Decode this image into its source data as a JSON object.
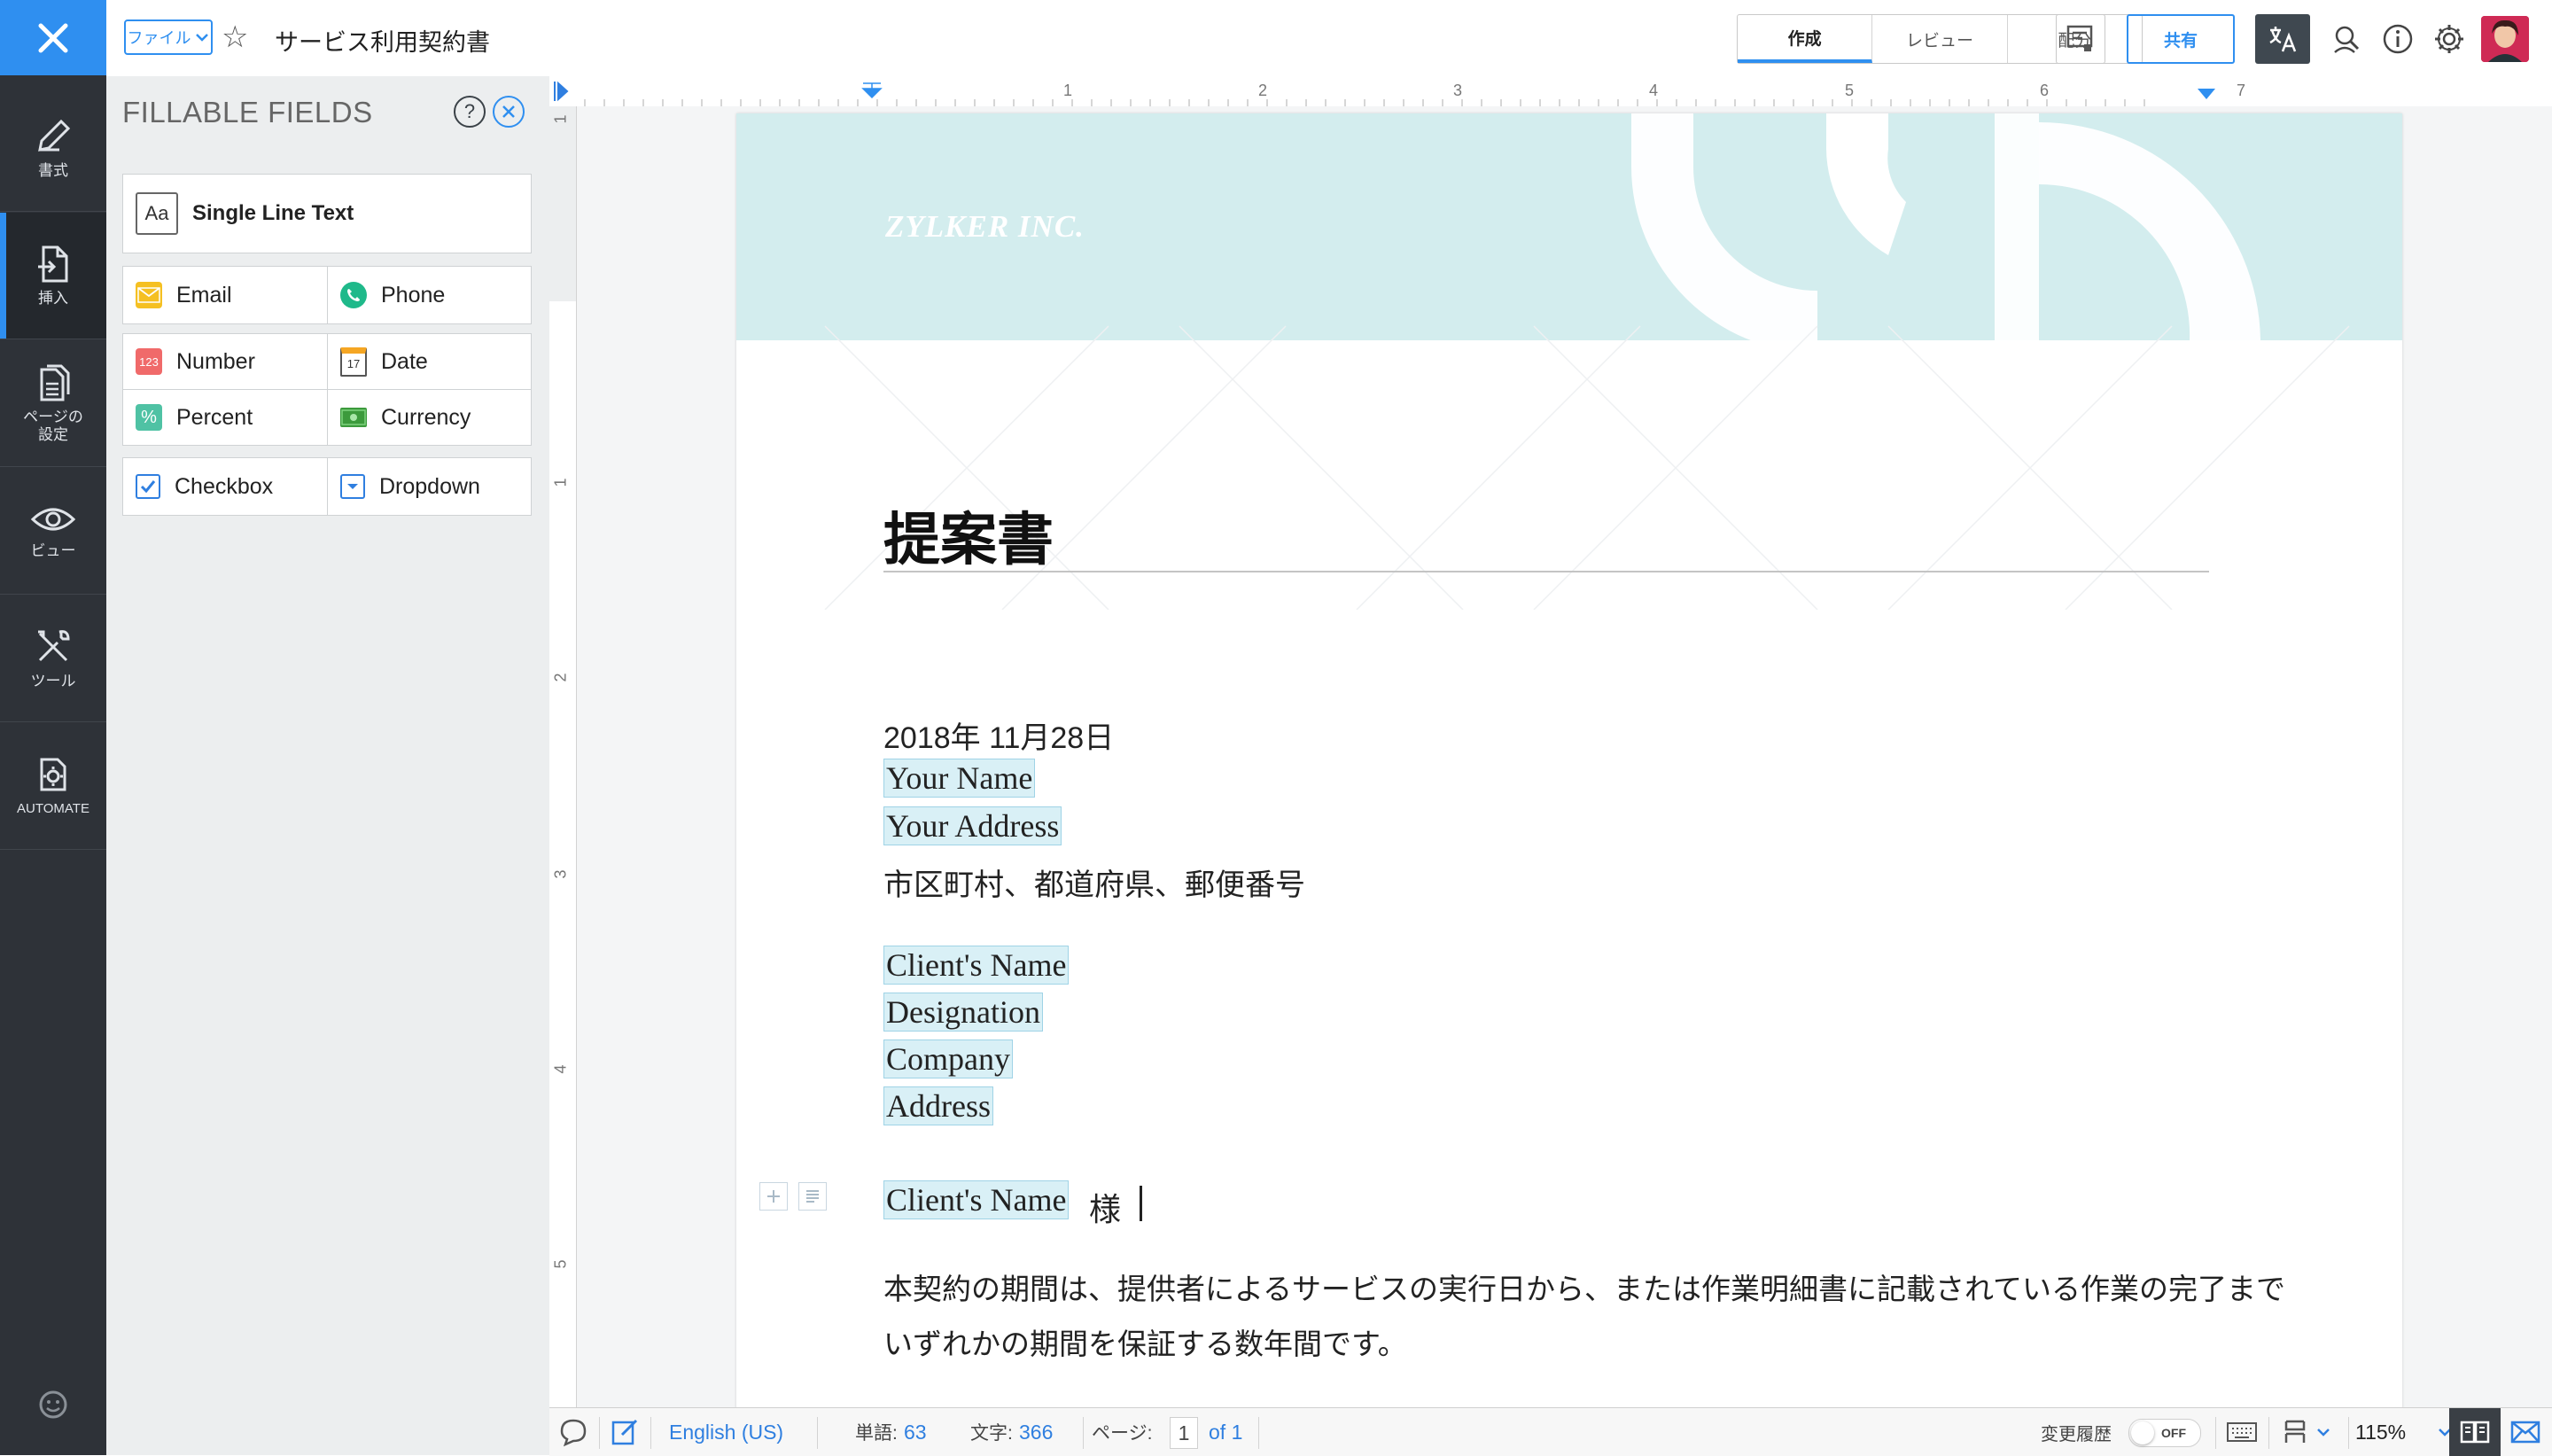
{
  "sidebar": {
    "items": [
      {
        "label": "書式",
        "icon": "pen-icon"
      },
      {
        "label": "挿入",
        "icon": "insert-document-icon"
      },
      {
        "label": "ページの\n設定",
        "icon": "page-setup-icon"
      },
      {
        "label": "ビュー",
        "icon": "eye-icon"
      },
      {
        "label": "ツール",
        "icon": "tools-icon"
      },
      {
        "label": "AUTOMATE",
        "icon": "automate-gear-icon"
      }
    ],
    "active_index": 1
  },
  "topbar": {
    "file_button": "ファイル",
    "document_title": "サービス利用契約書",
    "mode_tabs": [
      "作成",
      "レビュー",
      "配分"
    ],
    "active_mode": "作成",
    "share_button": "共有"
  },
  "fields_panel": {
    "title": "FILLABLE FIELDS",
    "help_icon": "?",
    "single_line_text": "Single Line Text",
    "fields": {
      "email": "Email",
      "phone": "Phone",
      "number": "Number",
      "number_icon_text": "123",
      "date": "Date",
      "date_icon_text": "17",
      "percent": "Percent",
      "currency": "Currency",
      "checkbox": "Checkbox",
      "dropdown": "Dropdown"
    }
  },
  "ruler": {
    "top_numbers": [
      "1",
      "2",
      "3",
      "4",
      "5",
      "6",
      "7"
    ],
    "left_numbers": [
      "1",
      "1",
      "2",
      "3",
      "4",
      "5"
    ]
  },
  "document": {
    "brand": "ZYLKER INC.",
    "heading": "提案書",
    "date": "2018年 11月28日",
    "your_name": "Your Name",
    "your_address": "Your Address",
    "city_line": "市区町村、都道府県、郵便番号",
    "client_name": "Client's Name",
    "designation": "Designation",
    "company": "Company",
    "address": "Address",
    "salutation_field": "Client's Name",
    "salutation_suffix": "様",
    "body_line1": "本契約の期間は、提供者によるサービスの実行日から、または作業明細書に記載されている作業の完了まで",
    "body_line2": "いずれかの期間を保証する数年間です。"
  },
  "statusbar": {
    "language": "English (US)",
    "words_label": "単語:",
    "words_count": "63",
    "chars_label": "文字:",
    "chars_count": "366",
    "page_label": "ページ:",
    "page_current": "1",
    "page_total": "of 1",
    "track_changes_label": "変更履歴",
    "track_changes_state": "OFF",
    "zoom": "115%"
  },
  "colors": {
    "accent": "#2f8ff0",
    "rail": "#2e3238",
    "header_band": "#d3edee",
    "field_highlight": "#d9f0f6"
  }
}
